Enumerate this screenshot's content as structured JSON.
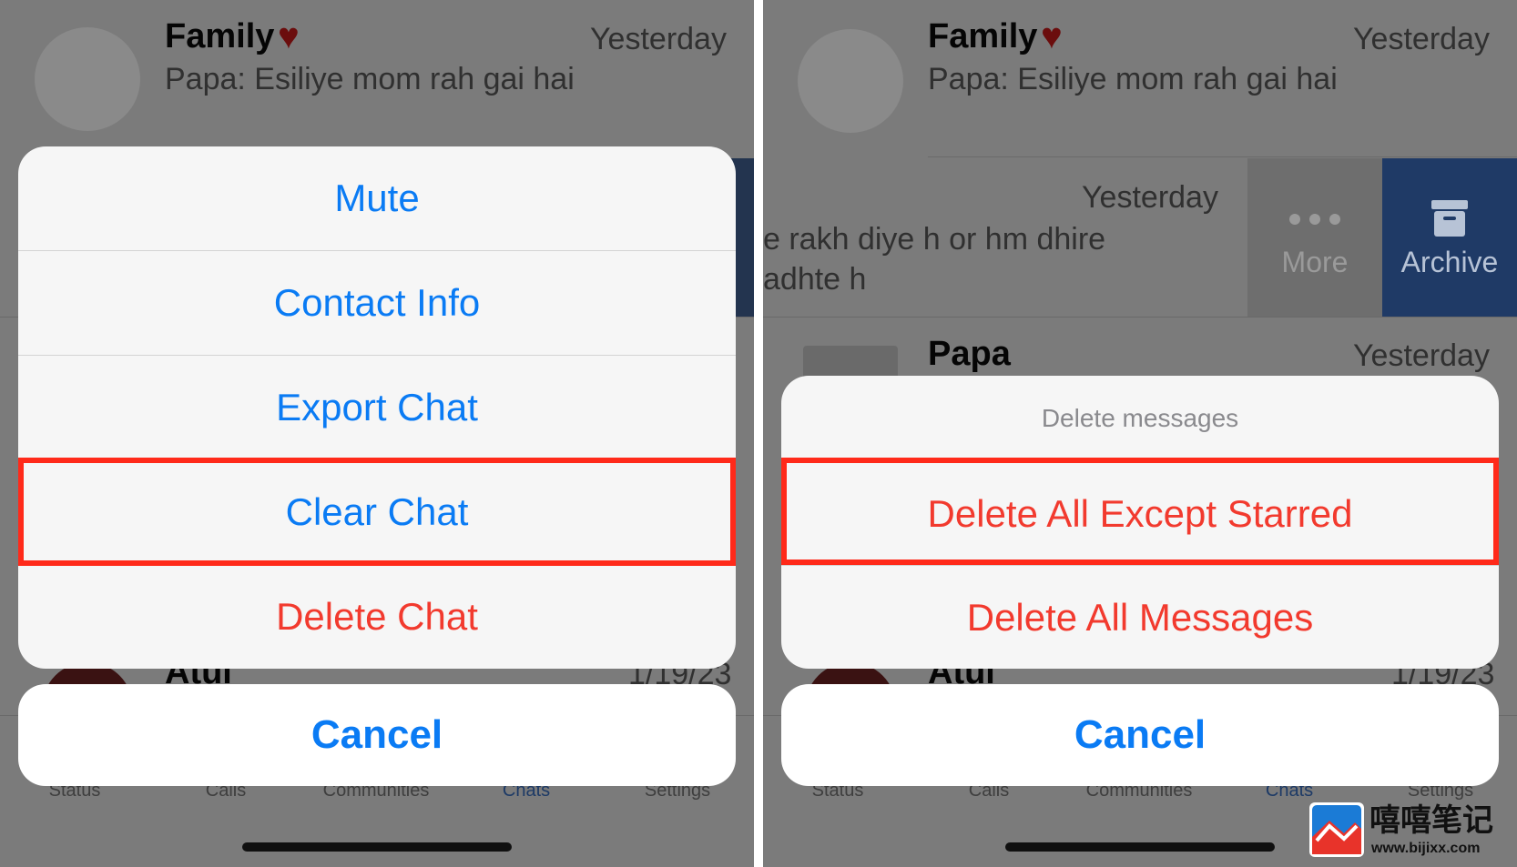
{
  "left": {
    "chat_top": {
      "name": "Family",
      "time": "Yesterday",
      "preview": "Papa: Esiliye mom rah gai hai"
    },
    "chat_bottom": {
      "name": "Atul",
      "time": "1/19/23"
    },
    "menu": {
      "items": [
        "Mute",
        "Contact Info",
        "Export Chat",
        "Clear Chat",
        "Delete Chat"
      ],
      "highlighted": "Clear Chat"
    },
    "cancel_label": "Cancel"
  },
  "right": {
    "chat_top": {
      "name": "Family",
      "time": "Yesterday",
      "preview": "Papa: Esiliye mom rah gai hai"
    },
    "chat_swiped": {
      "time": "Yesterday",
      "line1": "e rakh diye h or hm dhire",
      "line2": "adhte h"
    },
    "swipe_actions": {
      "more_label": "More",
      "archive_label": "Archive"
    },
    "chat_papa": {
      "name": "Papa",
      "time": "Yesterday"
    },
    "chat_bottom": {
      "name": "Atul",
      "time": "1/19/23"
    },
    "menu": {
      "title": "Delete messages",
      "items": [
        "Delete All Except Starred",
        "Delete All Messages"
      ],
      "highlighted": "Delete All Except Starred"
    },
    "cancel_label": "Cancel"
  },
  "tabbar": [
    "Status",
    "Calls",
    "Communities",
    "Chats",
    "Settings"
  ],
  "tabbar_active": "Chats",
  "watermark": {
    "brand": "嘻嘻笔记",
    "url": "www.bijixx.com"
  },
  "colors": {
    "ios_blue": "#0a7bf4",
    "destructive_red": "#f23a2e",
    "highlight_red": "#ff2a1a",
    "archive_blue": "#1f3a66"
  }
}
